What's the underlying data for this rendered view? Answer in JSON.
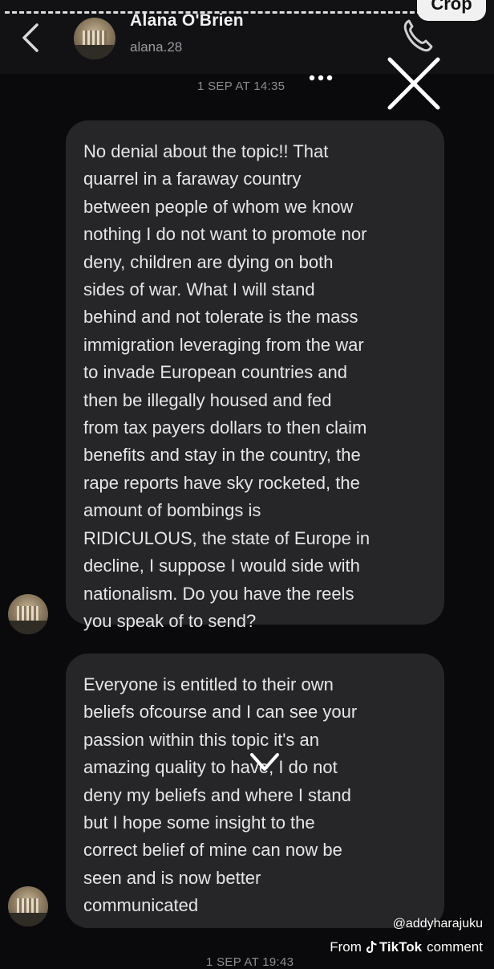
{
  "header": {
    "contact_name": "Alana O'Brien",
    "contact_handle": "alana.28",
    "crop_label": "Crop"
  },
  "thread": {
    "timestamp_top": "1 SEP AT 14:35",
    "messages": [
      {
        "text": "No denial about the topic!! That\nquarrel in a faraway country\nbetween people of whom we know\nnothing I do not want to promote nor\ndeny, children are dying on both\nsides of war. What I will stand\nbehind and not tolerate is the mass\nimmigration leveraging from the war\nto invade European countries and\nthen be illegally housed and fed\nfrom tax payers dollars to then claim\nbenefits and stay in the country, the\nrape reports have sky rocketed, the\namount of bombings is\nRIDICULOUS, the state of Europe in\ndecline, I suppose I would side with\nnationalism. Do you have the reels\nyou speak of to send?"
      },
      {
        "text": "Everyone is entitled to their own\nbeliefs ofcourse and I can see your\npassion within this topic it's an\namazing quality to have, I do not\ndeny my beliefs and where I stand\nbut I hope some insight to the\ncorrect belief of mine can now be\nseen and is now better\ncommunicated"
      }
    ],
    "timestamp_bottom": "1 SEP AT 19:43"
  },
  "watermark": {
    "handle": "@addyharajuku",
    "from_label": "From",
    "brand": "TikTok",
    "suffix": "comment"
  },
  "icons": {
    "back": "chevron-left-icon",
    "call": "phone-icon",
    "more": "more-dots-icon",
    "close": "close-icon",
    "scroll": "chevron-down-icon"
  }
}
